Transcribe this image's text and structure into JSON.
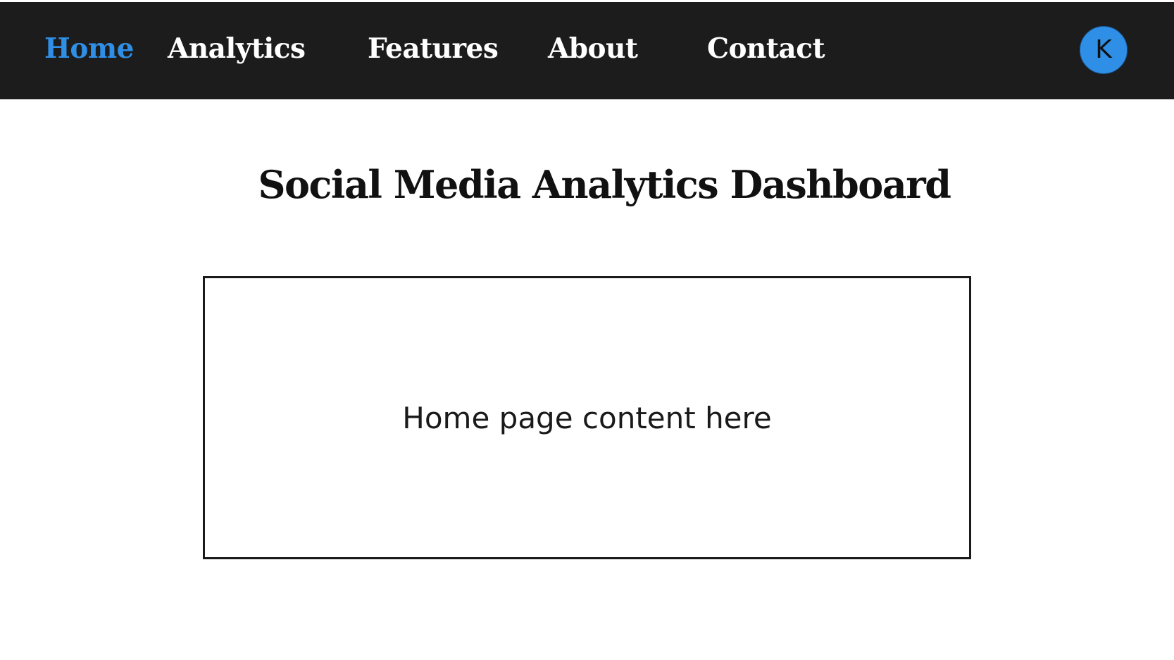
{
  "nav": {
    "items": [
      {
        "label": "Home",
        "active": true
      },
      {
        "label": "Analytics",
        "active": false
      },
      {
        "label": "Features",
        "active": false
      },
      {
        "label": "About",
        "active": false
      },
      {
        "label": "Contact",
        "active": false
      }
    ],
    "active_color": "#2f8fe6",
    "background": "#1c1c1c"
  },
  "user": {
    "avatar_initial": "K",
    "avatar_color": "#2f8fe6"
  },
  "page": {
    "title": "Social Media Analytics Dashboard",
    "content_text": "Home page content here"
  }
}
